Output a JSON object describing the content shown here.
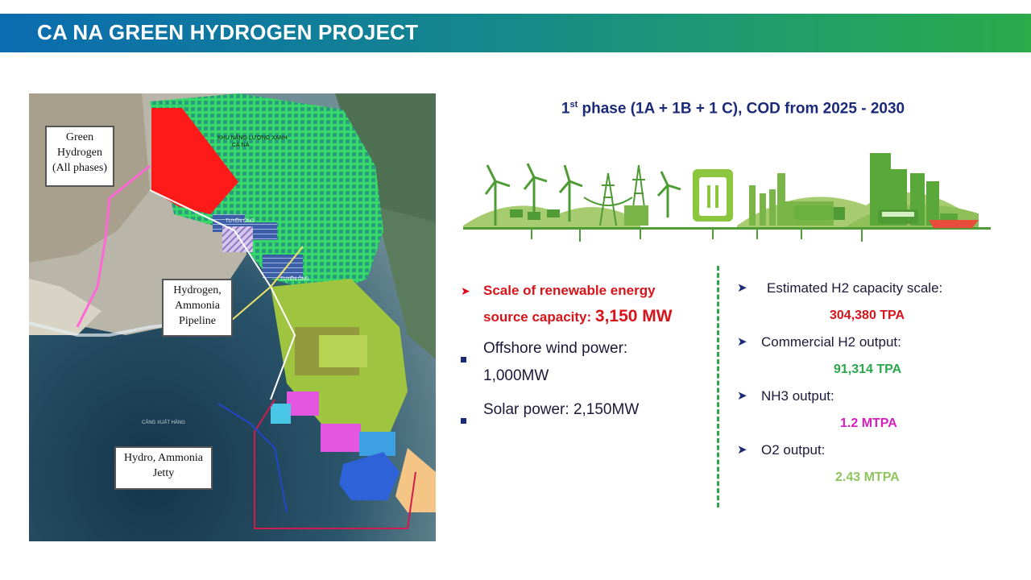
{
  "slide": {
    "title": "CA NA GREEN HYDROGEN PROJECT",
    "header_gradient": [
      "#0b6cb0",
      "#2bab4a"
    ]
  },
  "phase": {
    "ordinal": "1",
    "ordinal_suffix": "st",
    "text": " phase (1A + 1B + 1 C), COD from 2025 - 2030"
  },
  "map": {
    "callouts": {
      "green_hydrogen": [
        "Green",
        "Hydrogen",
        "(All phases)"
      ],
      "pipeline": [
        "Hydrogen,",
        "Ammonia",
        "Pipeline"
      ],
      "jetty": [
        "Hydro, Ammonia",
        "Jetty"
      ]
    },
    "labels": {
      "zone_line1": "KHU NĂNG LƯỢNG XANH",
      "zone_line2": "CÀ NÁ",
      "route1": "TUYẾN ỐNG",
      "route2": "TUYẾN ỐNG",
      "port": "CẢNG XUẤT HÀNG"
    }
  },
  "capacity": {
    "scale_label_line1": "Scale of renewable energy",
    "scale_label_line2": "source capacity: ",
    "scale_value": "3,150 MW",
    "offshore_line1": "Offshore wind power:",
    "offshore_line2": "1,000MW",
    "solar": "Solar power: 2,150MW"
  },
  "outputs": [
    {
      "label": "Estimated H2 capacity scale:",
      "value": "304,380 TPA",
      "color": "#d7141a"
    },
    {
      "label": "Commercial H2 output:",
      "value": "91,314 TPA",
      "color": "#2aa64b"
    },
    {
      "label": "NH3 output:",
      "value": "1.2 MTPA",
      "color": "#d61fbf"
    },
    {
      "label": "O2 output:",
      "value": "2.43 MTPA",
      "color": "#8fc45f"
    }
  ]
}
